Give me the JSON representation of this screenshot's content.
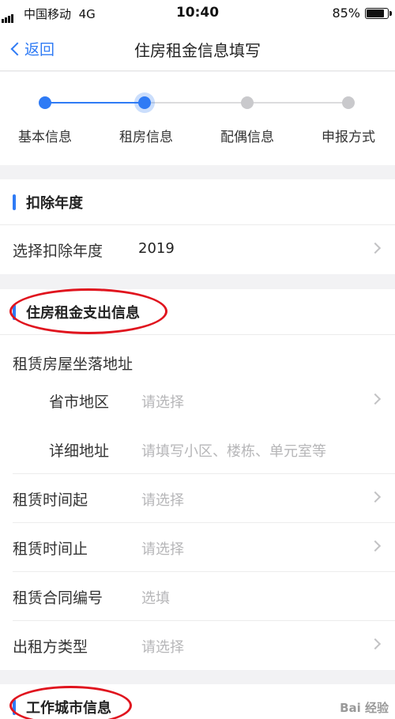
{
  "status_bar": {
    "carrier": "中国移动",
    "network": "4G",
    "time": "10:40",
    "battery": "85%"
  },
  "nav": {
    "back_label": "返回",
    "title": "住房租金信息填写"
  },
  "stepper": {
    "steps": [
      {
        "label": "基本信息",
        "state": "done"
      },
      {
        "label": "租房信息",
        "state": "current"
      },
      {
        "label": "配偶信息",
        "state": "pending"
      },
      {
        "label": "申报方式",
        "state": "pending"
      }
    ],
    "accent_color": "#2f7bf5"
  },
  "sections": {
    "deduction_year": {
      "title": "扣除年度",
      "row_label": "选择扣除年度",
      "row_value": "2019"
    },
    "rent_expense": {
      "title": "住房租金支出信息",
      "address_group_label": "租赁房屋坐落地址",
      "province_label": "省市地区",
      "province_placeholder": "请选择",
      "detail_label": "详细地址",
      "detail_placeholder": "请填写小区、楼栋、单元室等",
      "start_label": "租赁时间起",
      "start_placeholder": "请选择",
      "end_label": "租赁时间止",
      "end_placeholder": "请选择",
      "contract_label": "租赁合同编号",
      "contract_placeholder": "选填",
      "lessor_label": "出租方类型",
      "lessor_placeholder": "请选择"
    },
    "work_city": {
      "title": "工作城市信息"
    }
  },
  "watermark": "Bai 经验"
}
